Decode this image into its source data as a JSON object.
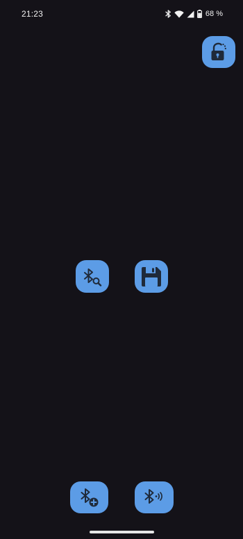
{
  "status_bar": {
    "time": "21:23",
    "battery_percent": "68 %",
    "icons": [
      "bluetooth-icon",
      "wifi-icon",
      "cellular-signal-icon",
      "battery-icon"
    ]
  },
  "actions": {
    "lock": {
      "icon": "lock-open-icon"
    },
    "bluetooth_search": {
      "icon": "bluetooth-search-icon"
    },
    "save": {
      "icon": "save-icon"
    },
    "bluetooth_add": {
      "icon": "bluetooth-add-icon"
    },
    "bluetooth_broadcast": {
      "icon": "bluetooth-broadcast-icon"
    }
  },
  "colors": {
    "background": "#141218",
    "button": "#5c9ce6",
    "icon": "#1f2a3a"
  }
}
